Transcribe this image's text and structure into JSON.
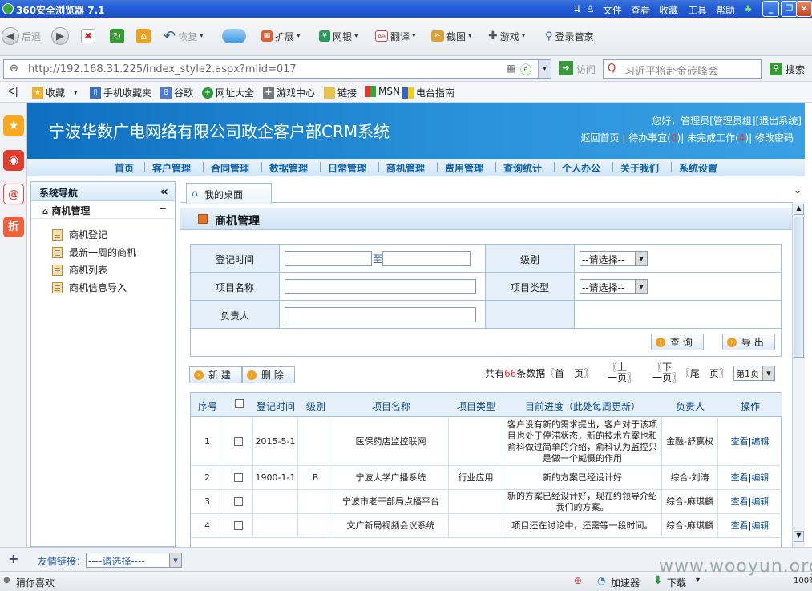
{
  "browser": {
    "title": "360安全浏览器 7.1",
    "menu": [
      "文件",
      "查看",
      "收藏",
      "工具",
      "帮助"
    ],
    "toolbar": {
      "back": "后退",
      "restore": "恢复",
      "ext": "扩展",
      "bank": "网银",
      "translate": "翻译",
      "screenshot": "截图",
      "games": "游戏",
      "login": "登录管家"
    },
    "url": "http://192.168.31.225/index_style2.aspx?mlid=017",
    "visit": "访问",
    "search_value": "习近平将赴金砖峰会",
    "search_btn": "搜索",
    "favorites": [
      "收藏",
      "手机收藏夹",
      "谷歌",
      "网址大全",
      "游戏中心",
      "链接",
      "MSN",
      "电台指南"
    ],
    "friend_label": "友情链接：",
    "friend_select": "----请选择----",
    "status_left": "猜你喜欢",
    "status_accel": "加速器",
    "status_download": "下载",
    "zoom": "100%",
    "watermark": "www.wooyun.org"
  },
  "header": {
    "system_title": "宁波华数广电网络有限公司政企客户部CRM系统",
    "greeting": "您好，管理员[管理员组]",
    "logout": "[退出系统]",
    "home": "返回首页",
    "todo": "待办事宜(",
    "todo_count": "0",
    "todo_end": ")",
    "unfinished": "未完成工作(",
    "unfinished_count": "4",
    "unfinished_end": ")",
    "change_pwd": "修改密码"
  },
  "nav": [
    "首页",
    "客户管理",
    "合同管理",
    "数据管理",
    "日常管理",
    "商机管理",
    "费用管理",
    "查询统计",
    "个人办公",
    "关于我们",
    "系统设置"
  ],
  "sidebar": {
    "title": "系统导航",
    "section": "商机管理",
    "items": [
      "商机登记",
      "最新一周的商机",
      "商机列表",
      "商机信息导入"
    ]
  },
  "main": {
    "tab": "我的桌面",
    "module_title": "商机管理"
  },
  "form": {
    "reg_time": "登记时间",
    "to": "至",
    "level": "级别",
    "level_sel": "--请选择--",
    "project_name": "项目名称",
    "project_type": "项目类型",
    "type_sel": "--请选择--",
    "owner": "负责人",
    "query": "查 询",
    "export": "导 出"
  },
  "actions": {
    "new": "新 建",
    "delete": "删 除"
  },
  "pager": {
    "total_pre": "共有",
    "total": "66",
    "total_post": "条数据",
    "first": "〖首　页〗",
    "prev": "〖上一页〗",
    "next": "〖下一页〗",
    "last": "〖尾　页〗",
    "page_sel": "第1页"
  },
  "table": {
    "headers": [
      "序号",
      "",
      "登记时间",
      "级别",
      "项目名称",
      "项目类型",
      "目前进度（此处每周更新）",
      "负责人",
      "操作"
    ],
    "rows": [
      {
        "no": "1",
        "date": "2015-5-1",
        "level": "",
        "name": "医保药店监控联网",
        "type": "",
        "progress": "客户没有新的需求提出，客户对于该项目也处于停滞状态，新的技术方案也和俞科做过简单的介绍，俞科认为监控只是做一个威慑的作用",
        "owner": "金融-舒赢权"
      },
      {
        "no": "2",
        "date": "1900-1-1",
        "level": "B",
        "name": "宁波大学广播系统",
        "type": "行业应用",
        "progress": "新的方案已经设计好",
        "owner": "综合-刘涛"
      },
      {
        "no": "3",
        "date": "",
        "level": "",
        "name": "宁波市老干部局点播平台",
        "type": "",
        "progress": "新的方案已经设计好，现在约领导介绍我们的方案。",
        "owner": "综合-麻琪麟"
      },
      {
        "no": "4",
        "date": "",
        "level": "",
        "name": "文广新局视频会议系统",
        "type": "",
        "progress": "项目还在讨论中，还需等一段时间。",
        "owner": "综合-麻琪麟"
      }
    ],
    "view": "查看",
    "sep": "|",
    "edit": "编辑"
  }
}
